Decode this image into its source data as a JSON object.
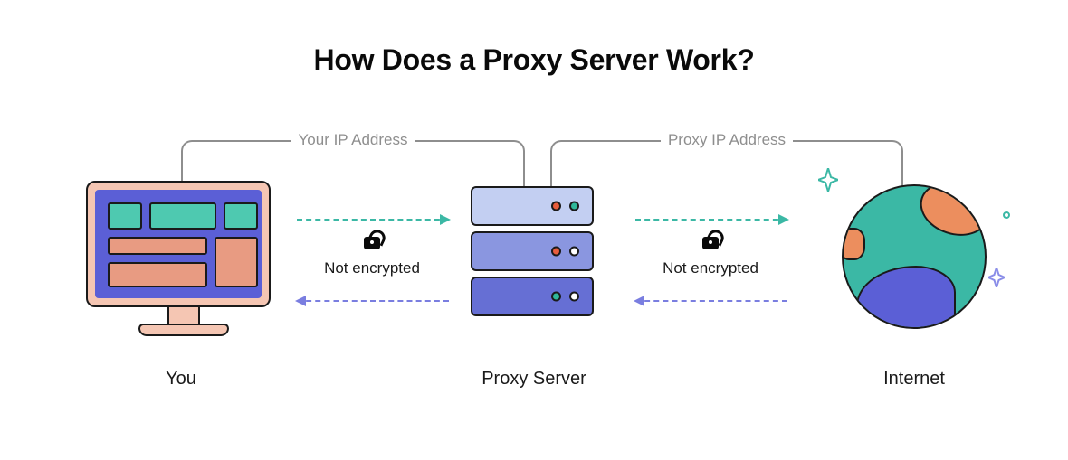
{
  "title": "How Does a Proxy Server Work?",
  "brackets": {
    "left": "Your IP Address",
    "right": "Proxy IP Address"
  },
  "encryption": {
    "left": "Not encrypted",
    "right": "Not encrypted"
  },
  "nodes": {
    "you": "You",
    "proxy": "Proxy Server",
    "internet": "Internet"
  },
  "icons": {
    "lock_left": "open-lock-icon",
    "lock_right": "open-lock-icon",
    "sparkle": "sparkle-icon"
  }
}
